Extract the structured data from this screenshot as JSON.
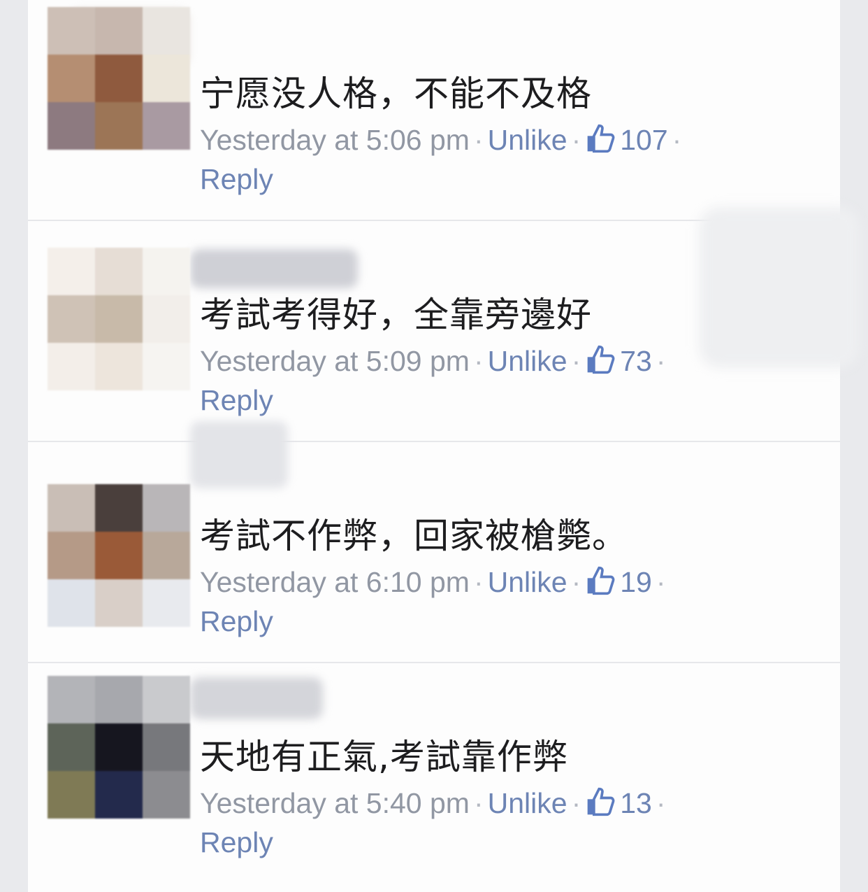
{
  "comments": [
    {
      "text": "宁愿没人格，不能不及格",
      "time": "Yesterday at 5:06 pm",
      "unlike_label": "Unlike",
      "likes": "107",
      "reply_label": "Reply",
      "avatar_colors": [
        "#cdbfb6",
        "#c7b7ae",
        "#e9e5e0",
        "#b58e72",
        "#8f5a3e",
        "#ece6da",
        "#8d7a80",
        "#9c7556",
        "#a99aa2"
      ]
    },
    {
      "text": "考試考得好，全靠旁邊好",
      "time": "Yesterday at 5:09 pm",
      "unlike_label": "Unlike",
      "likes": "73",
      "reply_label": "Reply",
      "avatar_colors": [
        "#f4efea",
        "#e6ddd5",
        "#f5f3ef",
        "#cfc2b6",
        "#c8baa9",
        "#f2eeea",
        "#f3eee9",
        "#ede5dc",
        "#f6f4f1"
      ]
    },
    {
      "text": "考試不作弊，回家被槍斃。",
      "time": "Yesterday at 6:10 pm",
      "unlike_label": "Unlike",
      "likes": "19",
      "reply_label": "Reply",
      "avatar_colors": [
        "#c9beb6",
        "#4a3f3c",
        "#b9b6b8",
        "#b59a87",
        "#9a5a38",
        "#b8a89a",
        "#dfe3ea",
        "#d9cfc8",
        "#e8eaee"
      ]
    },
    {
      "text": "天地有正氣,考試靠作弊",
      "time": "Yesterday at 5:40 pm",
      "unlike_label": "Unlike",
      "likes": "13",
      "reply_label": "Reply",
      "avatar_colors": [
        "#b3b4b8",
        "#a7a8ad",
        "#c9cacd",
        "#5d6459",
        "#16161f",
        "#77787c",
        "#7f7a55",
        "#232a4c",
        "#8c8c90"
      ]
    }
  ],
  "colors": {
    "comment_text": "#1d1d1f",
    "meta_gray": "#9197a3",
    "link_blue": "#6d84b4",
    "like_blue": "#5b7bc0"
  },
  "icons": {
    "like": "thumbs-up-icon"
  }
}
